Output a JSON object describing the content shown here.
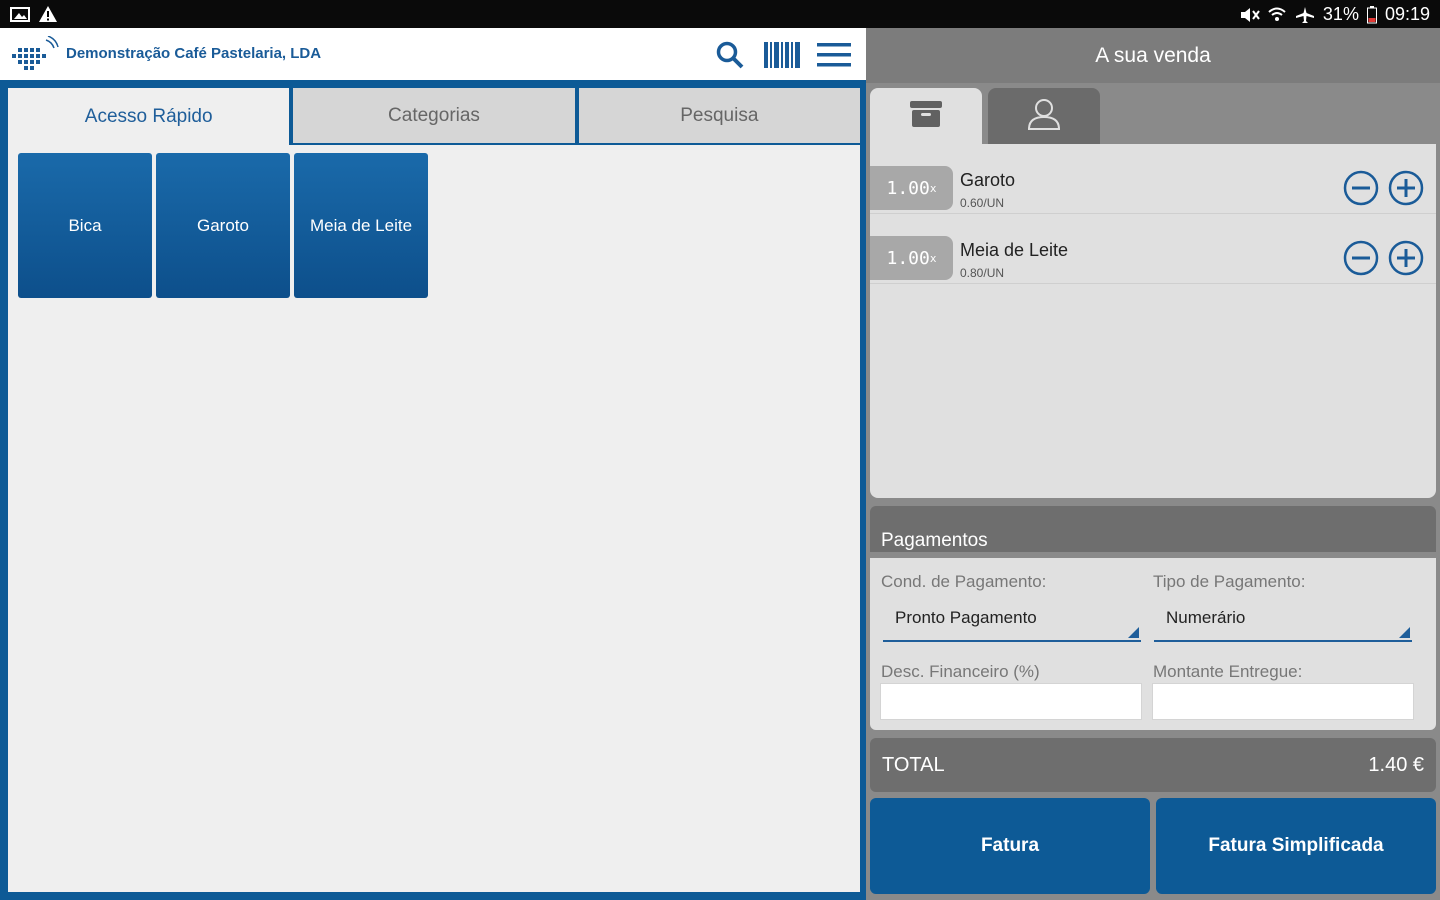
{
  "status_bar": {
    "battery": "31%",
    "time": "09:19"
  },
  "app": {
    "company_name": "Demonstração Café Pastelaria, LDA"
  },
  "tabs": [
    {
      "label": "Acesso Rápido",
      "active": true
    },
    {
      "label": "Categorias",
      "active": false
    },
    {
      "label": "Pesquisa",
      "active": false
    }
  ],
  "tiles": [
    {
      "label": "Bica"
    },
    {
      "label": "Garoto"
    },
    {
      "label": "Meia de Leite"
    }
  ],
  "sale": {
    "title": "A sua venda",
    "items": [
      {
        "qty": "1.00",
        "qty_unit": "x",
        "name": "Garoto",
        "price": "0.60/UN"
      },
      {
        "qty": "1.00",
        "qty_unit": "x",
        "name": "Meia de Leite",
        "price": "0.80/UN"
      }
    ]
  },
  "payments": {
    "title": "Pagamentos",
    "cond_label": "Cond. de Pagamento:",
    "cond_value": "Pronto Pagamento",
    "tipo_label": "Tipo de Pagamento:",
    "tipo_value": "Numerário",
    "desc_label": "Desc. Financeiro (%)",
    "desc_value": "",
    "montante_label": "Montante Entregue:",
    "montante_value": ""
  },
  "total": {
    "label": "TOTAL",
    "value": "1.40 €"
  },
  "buttons": {
    "fatura": "Fatura",
    "fatura_simplificada": "Fatura Simplificada"
  },
  "colors": {
    "primary": "#0d5a96",
    "panel_grey": "#e0e0e0",
    "header_grey": "#6e6e6e"
  }
}
